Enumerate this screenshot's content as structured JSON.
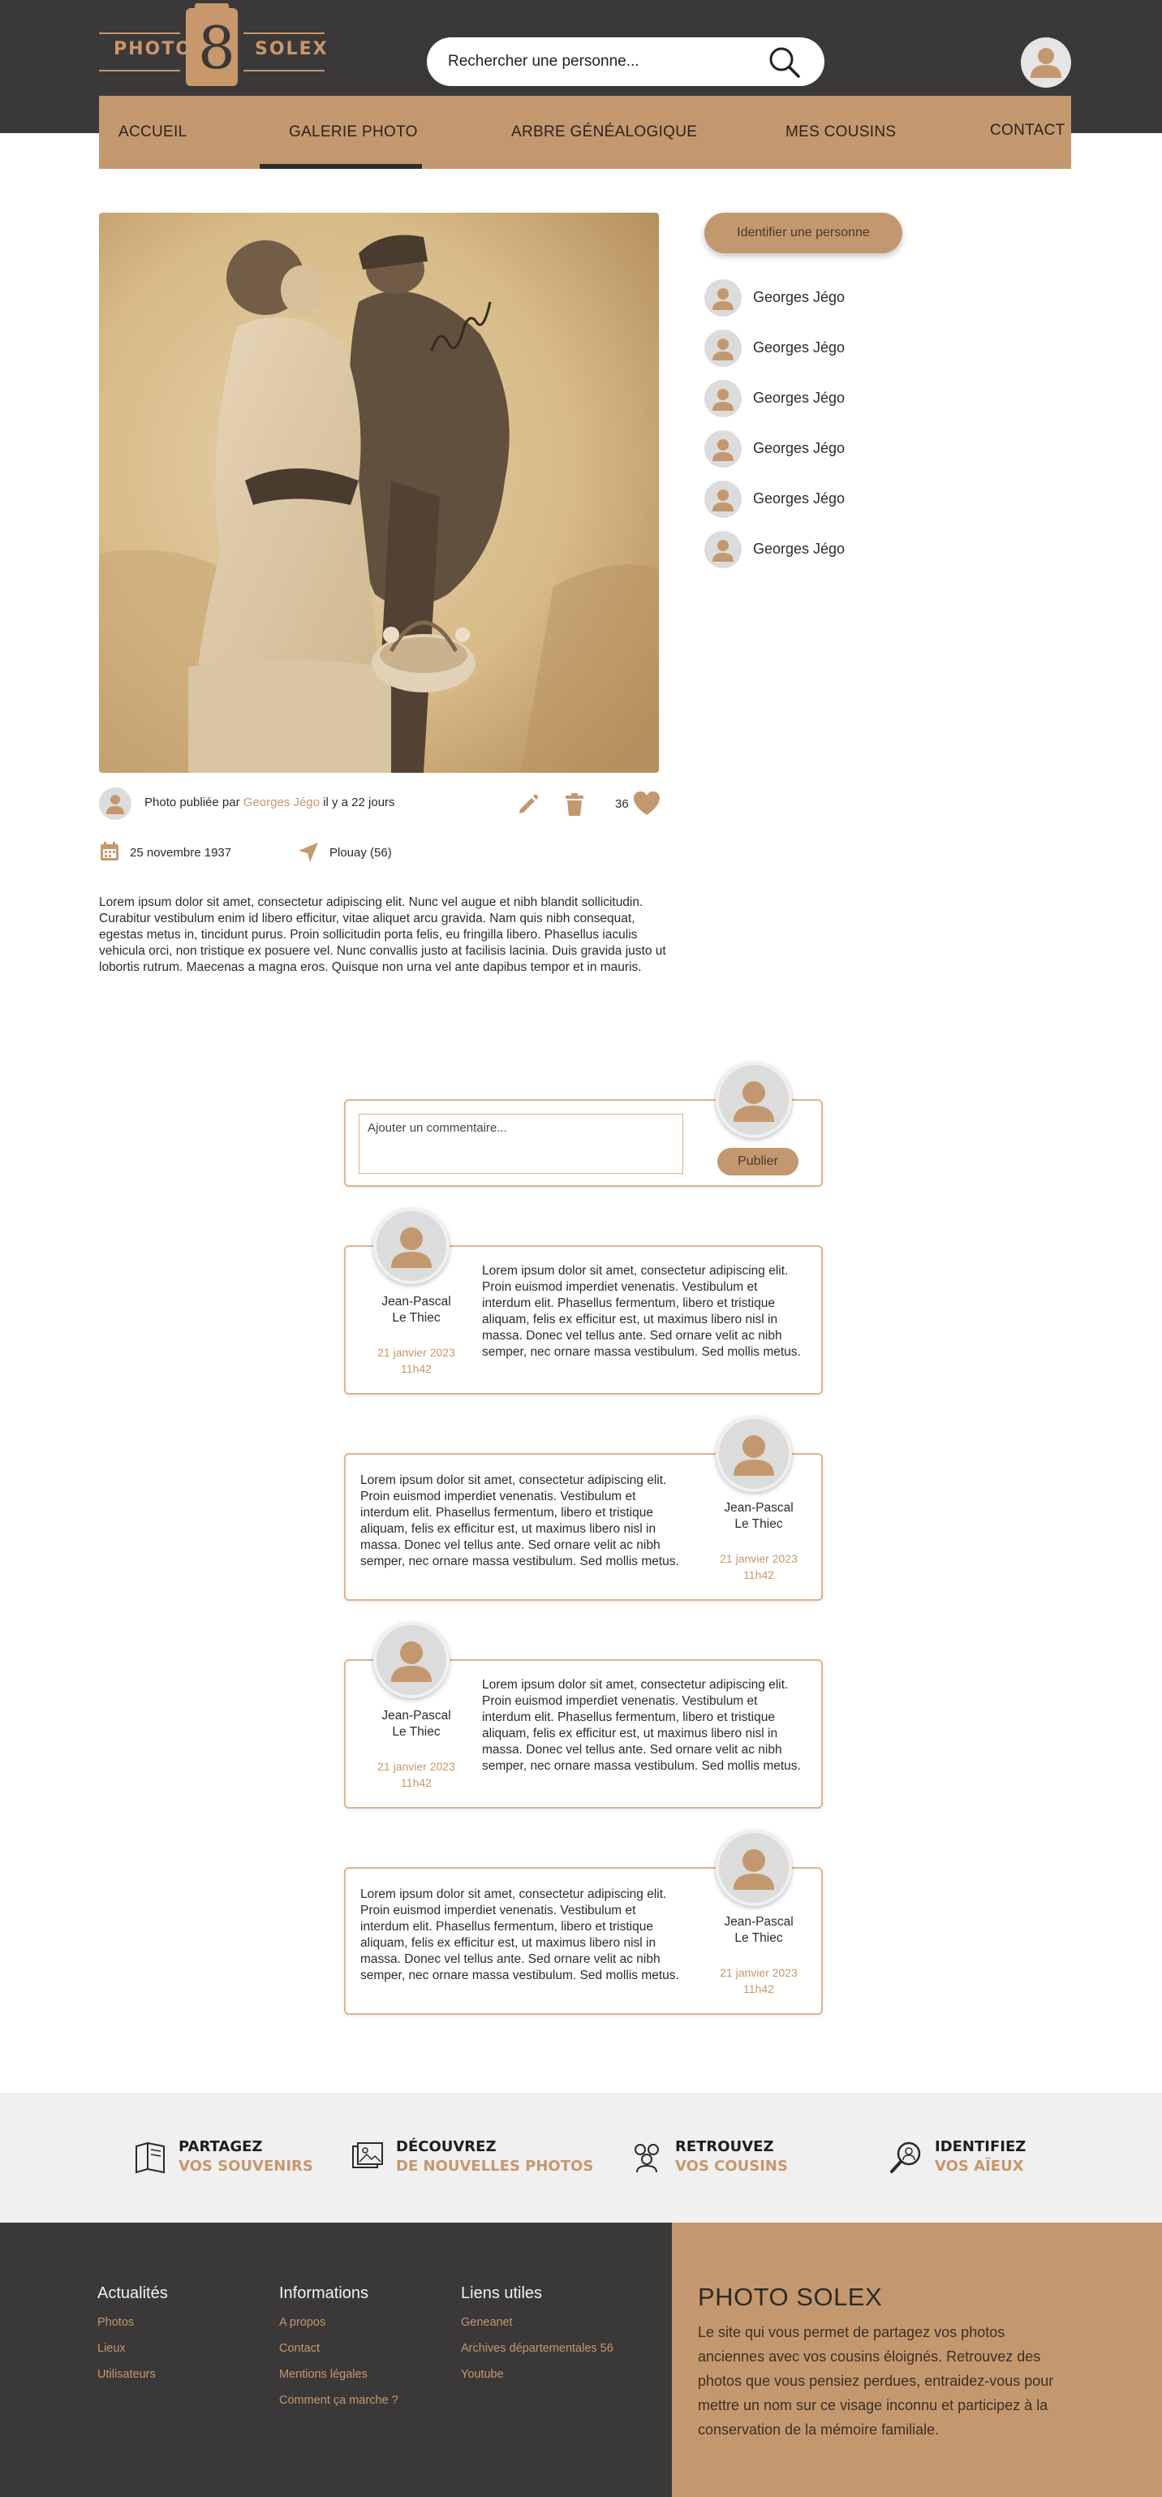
{
  "header": {
    "logo_left": "PHOTO",
    "logo_right": "SOLEX",
    "search_placeholder": "Rechercher une personne..."
  },
  "nav": {
    "items": [
      "ACCUEIL",
      "GALERIE PHOTO",
      "ARBRE GÉNÉALOGIQUE",
      "MES COUSINS",
      "CONTACT"
    ],
    "active": "GALERIE PHOTO"
  },
  "identify_button": "Identifier une personne",
  "people": [
    "Georges Jégo",
    "Georges Jégo",
    "Georges Jégo",
    "Georges Jégo",
    "Georges Jégo",
    "Georges Jégo"
  ],
  "post": {
    "published_prefix": "Photo publiée par",
    "author": "Georges Jégo",
    "published_suffix": "il y a 22 jours",
    "likes": "36",
    "date": "25 novembre 1937",
    "location": "Plouay (56)",
    "description": "Lorem ipsum dolor sit amet, consectetur adipiscing elit. Nunc vel augue et nibh blandit sollicitudin. Curabitur vestibulum enim id libero efficitur, vitae aliquet arcu gravida. Nam quis nibh consequat, egestas metus in, tincidunt purus. Proin sollicitudin porta felis, eu fringilla libero. Phasellus iaculis vehicula orci, non tristique ex posuere vel. Nunc convallis justo at facilisis lacinia. Duis gravida justo ut lobortis rutrum. Maecenas a magna eros. Quisque non urna vel ante dapibus tempor et in mauris."
  },
  "comment_form": {
    "placeholder": "Ajouter un commentaire...",
    "publish_label": "Publier"
  },
  "comments": [
    {
      "author_line1": "Jean-Pascal",
      "author_line2": "Le Thiec",
      "date": "21 janvier 2023",
      "time": "11h42",
      "text": "Lorem ipsum dolor sit amet, consectetur adipiscing elit. Proin euismod imperdiet venenatis. Vestibulum et interdum elit. Phasellus fermentum, libero et tristique aliquam, felis ex efficitur est, ut maximus libero nisl in massa. Donec vel tellus ante. Sed ornare velit ac nibh semper, nec ornare massa vestibulum. Sed mollis metus."
    },
    {
      "author_line1": "Jean-Pascal",
      "author_line2": "Le Thiec",
      "date": "21 janvier 2023",
      "time": "11h42",
      "text": "Lorem ipsum dolor sit amet, consectetur adipiscing elit. Proin euismod imperdiet venenatis. Vestibulum et interdum elit. Phasellus fermentum, libero et tristique aliquam, felis ex efficitur est, ut maximus libero nisl in massa. Donec vel tellus ante. Sed ornare velit ac nibh semper, nec ornare massa vestibulum. Sed mollis metus."
    },
    {
      "author_line1": "Jean-Pascal",
      "author_line2": "Le Thiec",
      "date": "21 janvier 2023",
      "time": "11h42",
      "text": "Lorem ipsum dolor sit amet, consectetur adipiscing elit. Proin euismod imperdiet venenatis. Vestibulum et interdum elit. Phasellus fermentum, libero et tristique aliquam, felis ex efficitur est, ut maximus libero nisl in massa. Donec vel tellus ante. Sed ornare velit ac nibh semper, nec ornare massa vestibulum. Sed mollis metus."
    },
    {
      "author_line1": "Jean-Pascal",
      "author_line2": "Le Thiec",
      "date": "21 janvier 2023",
      "time": "11h42",
      "text": "Lorem ipsum dolor sit amet, consectetur adipiscing elit. Proin euismod imperdiet venenatis. Vestibulum et interdum elit. Phasellus fermentum, libero et tristique aliquam, felis ex efficitur est, ut maximus libero nisl in massa. Donec vel tellus ante. Sed ornare velit ac nibh semper, nec ornare massa vestibulum. Sed mollis metus."
    }
  ],
  "features": [
    {
      "line1": "PARTAGEZ",
      "line2": "VOS SOUVENIRS",
      "icon": "book-icon"
    },
    {
      "line1": "DÉCOUVREZ",
      "line2": "DE NOUVELLES PHOTOS",
      "icon": "photos-icon"
    },
    {
      "line1": "RETROUVEZ",
      "line2": "VOS COUSINS",
      "icon": "people-icon"
    },
    {
      "line1": "IDENTIFIEZ",
      "line2": "VOS AÏEUX",
      "icon": "magnifier-person-icon"
    }
  ],
  "footer": {
    "columns": [
      {
        "title": "Actualités",
        "links": [
          "Photos",
          "Lieux",
          "Utilisateurs"
        ]
      },
      {
        "title": "Informations",
        "links": [
          "A propos",
          "Contact",
          "Mentions légales",
          "Comment ça marche ?"
        ]
      },
      {
        "title": "Liens utiles",
        "links": [
          "Geneanet",
          "Archives départementales 56",
          "Youtube"
        ]
      }
    ],
    "brand_title": "PHOTO SOLEX",
    "brand_text": "Le site qui vous permet de partagez vos photos anciennes avec vos cousins éloignés. Retrouvez des photos que vous pensiez perdues, entraidez-vous pour mettre un nom sur ce visage inconnu et participez à la conservation de la mémoire familiale."
  },
  "colors": {
    "accent": "#c4986e",
    "dark": "#3a3839",
    "light_bg": "#f0f0f0"
  }
}
